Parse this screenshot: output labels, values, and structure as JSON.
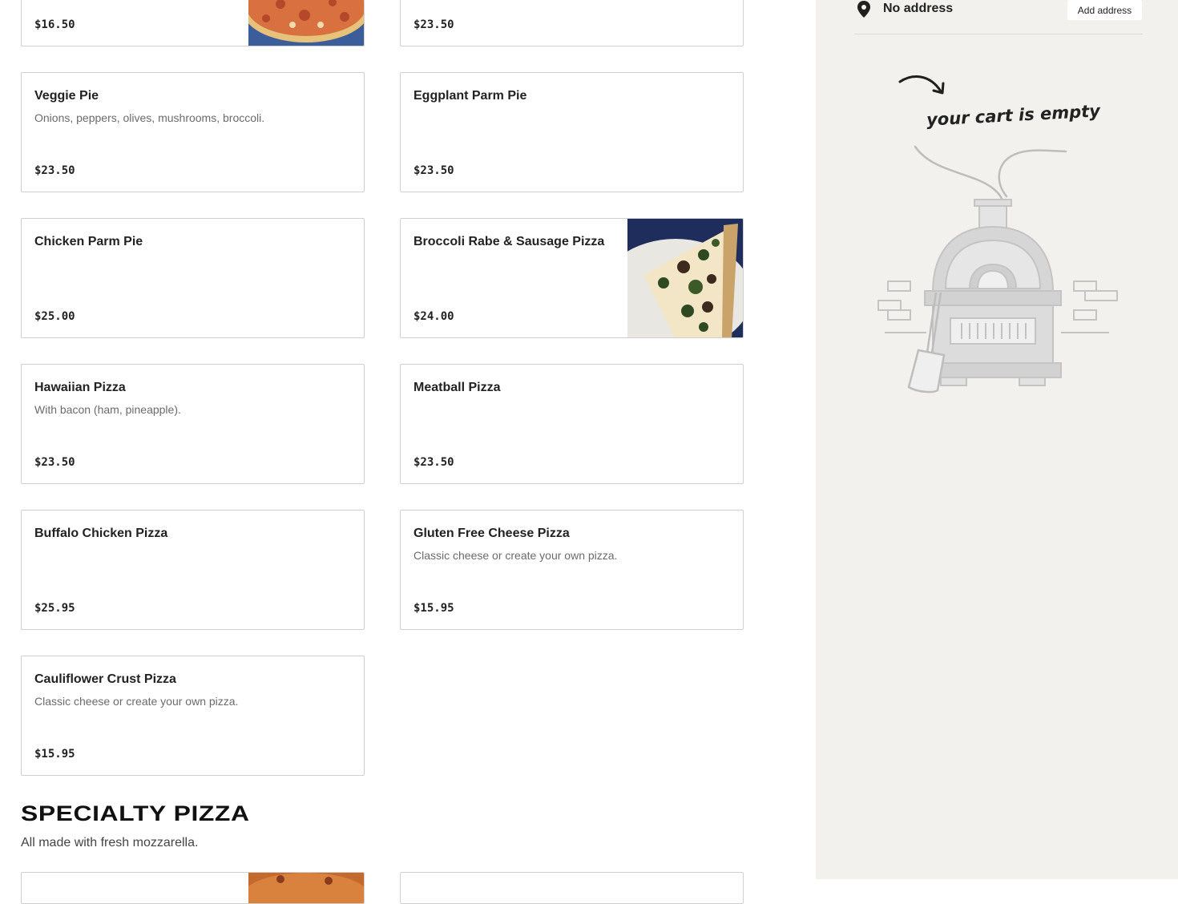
{
  "menu": {
    "items": [
      {
        "name": "",
        "description": "",
        "price": "$16.50"
      },
      {
        "name": "",
        "description": "",
        "price": "$23.50"
      },
      {
        "name": "Veggie Pie",
        "description": "Onions, peppers, olives, mushrooms, broccoli.",
        "price": "$23.50"
      },
      {
        "name": "Eggplant Parm Pie",
        "description": "",
        "price": "$23.50"
      },
      {
        "name": "Chicken Parm Pie",
        "description": "",
        "price": "$25.00"
      },
      {
        "name": "Broccoli Rabe & Sausage Pizza",
        "description": "",
        "price": "$24.00"
      },
      {
        "name": "Hawaiian Pizza",
        "description": "With bacon (ham, pineapple).",
        "price": "$23.50"
      },
      {
        "name": "Meatball Pizza",
        "description": "",
        "price": "$23.50"
      },
      {
        "name": "Buffalo Chicken Pizza",
        "description": "",
        "price": "$25.95"
      },
      {
        "name": "Gluten Free Cheese Pizza",
        "description": "Classic cheese or create your own pizza.",
        "price": "$15.95"
      },
      {
        "name": "Cauliflower Crust Pizza",
        "description": "Classic cheese or create your own pizza.",
        "price": "$15.95"
      }
    ]
  },
  "section": {
    "title": "SPECIALTY PIZZA",
    "subtitle": "All made with fresh mozzarella."
  },
  "sidebar": {
    "address": "No address",
    "add_address_label": "Add address",
    "empty_cart_text": "your cart is empty"
  },
  "icons": {
    "location": "map-pin-icon",
    "arrow": "curved-arrow-icon",
    "illustration": "pizza-oven-illustration"
  },
  "colors": {
    "sidebar_bg": "#f2f1ee",
    "card_border": "#cfcfcf",
    "text_dark": "#222222",
    "text_muted": "#6b6b6b"
  }
}
